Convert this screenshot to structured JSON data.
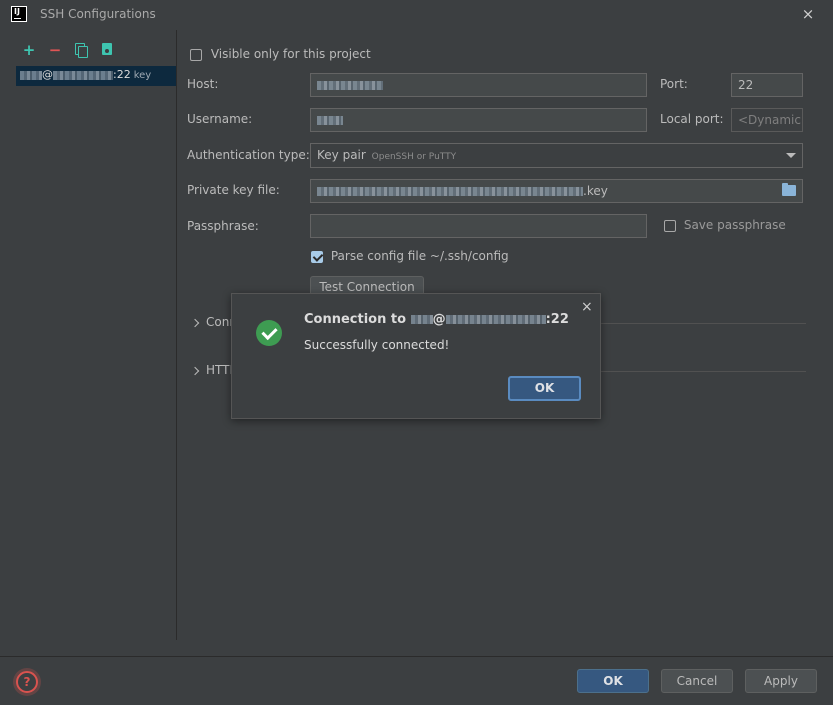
{
  "window": {
    "app_icon_text": "IJ",
    "title": "SSH Configurations",
    "close_icon": "×"
  },
  "sidebar": {
    "add_icon": "+",
    "remove_icon": "−",
    "config_item": {
      "port_text": ":22",
      "suffix": "key"
    }
  },
  "form": {
    "visible_only_label": "Visible only for this project",
    "visible_only_checked": false,
    "host_label": "Host:",
    "port_label": "Port:",
    "port_value": "22",
    "username_label": "Username:",
    "local_port_label": "Local port:",
    "local_port_placeholder": "<Dynamic>",
    "auth_type_label": "Authentication type:",
    "auth_type_value": "Key pair",
    "auth_type_hint": "OpenSSH or PuTTY",
    "private_key_label": "Private key file:",
    "private_key_suffix": ".key",
    "passphrase_label": "Passphrase:",
    "save_passphrase_label": "Save passphrase",
    "save_passphrase_checked": false,
    "parse_config_label": "Parse config file ~/.ssh/config",
    "parse_config_checked": true,
    "test_connection_label": "Test Connection",
    "section_connection_label": "Conn",
    "section_http_label": "HTTP"
  },
  "dialog": {
    "title_prefix": "Connection to",
    "title_at": "@",
    "title_suffix": ":22",
    "message": "Successfully connected!",
    "ok_label": "OK",
    "close_icon": "×"
  },
  "footer": {
    "help_icon": "?",
    "ok_label": "OK",
    "cancel_label": "Cancel",
    "apply_label": "Apply"
  }
}
